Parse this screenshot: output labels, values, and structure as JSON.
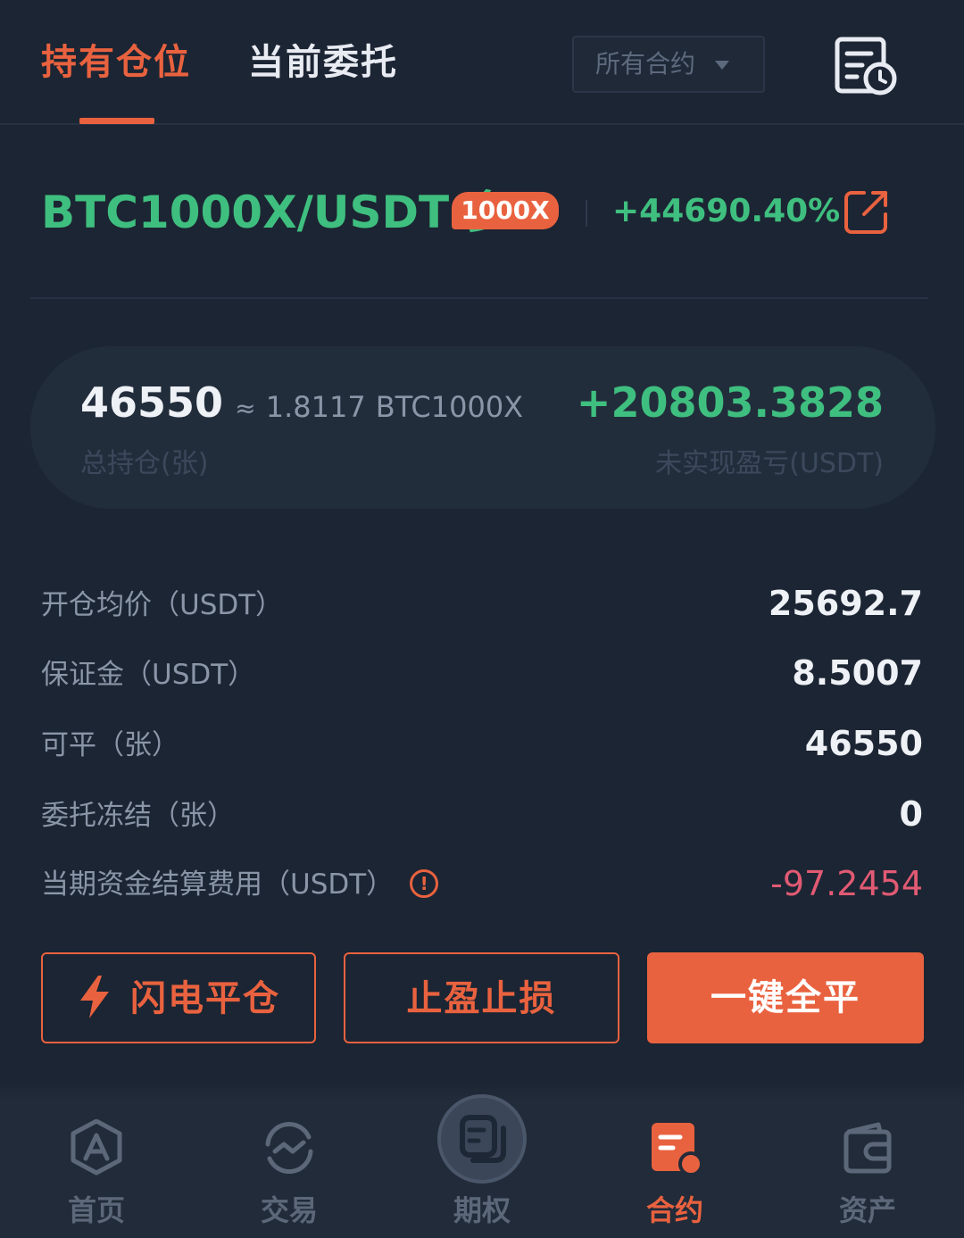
{
  "tabs": {
    "positions": "持有仓位",
    "orders": "当前委托"
  },
  "filter": {
    "selected": "所有合约"
  },
  "position": {
    "symbol": "BTC1000X/USDT·多",
    "leverage": "1000X",
    "pnl_percent": "+44690.40%",
    "total_qty": "46550",
    "approx_symbol": "≈",
    "approx_amount": "1.8117",
    "approx_unit": "BTC1000X",
    "total_qty_label": "总持仓(张)",
    "unrealized_pnl": "+20803.3828",
    "unrealized_pnl_label": "未实现盈亏(USDT)"
  },
  "details": [
    {
      "label": "开仓均价（USDT）",
      "value": "25692.7"
    },
    {
      "label": "保证金（USDT）",
      "value": "8.5007"
    },
    {
      "label": "可平（张）",
      "value": "46550"
    },
    {
      "label": "委托冻结（张）",
      "value": "0"
    },
    {
      "label": "当期资金结算费用（USDT）",
      "value": "-97.2454"
    }
  ],
  "actions": {
    "flash_close": "闪电平仓",
    "tp_sl": "止盈止损",
    "close_all": "一键全平"
  },
  "nav": {
    "home": "首页",
    "trade": "交易",
    "options": "期权",
    "contract": "合约",
    "assets": "资产"
  },
  "colors": {
    "accent": "#e9623f",
    "profit": "#3fbf7f",
    "loss": "#e15a73",
    "background": "#1c2533"
  }
}
